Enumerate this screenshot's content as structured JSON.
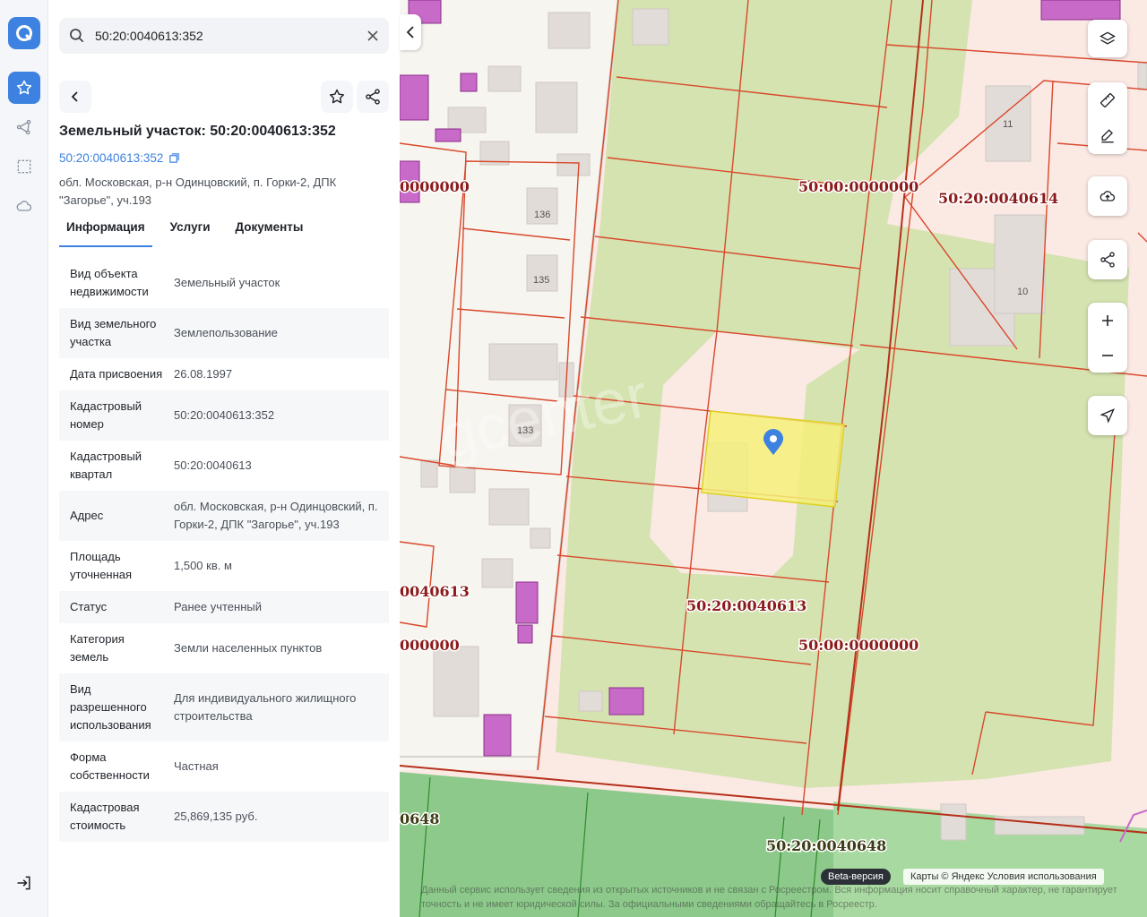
{
  "search": {
    "value": "50:20:0040613:352"
  },
  "object": {
    "title": "Земельный участок: 50:20:0040613:352",
    "cad_number": "50:20:0040613:352",
    "address": "обл. Московская, р-н Одинцовский, п. Горки-2, ДПК \"Загорье\", уч.193"
  },
  "tabs": [
    {
      "label": "Информация",
      "active": true
    },
    {
      "label": "Услуги",
      "active": false
    },
    {
      "label": "Документы",
      "active": false
    }
  ],
  "info_rows": [
    {
      "key": "Вид объекта недвижимости",
      "value": "Земельный участок"
    },
    {
      "key": "Вид земельного участка",
      "value": "Землепользование"
    },
    {
      "key": "Дата присвоения",
      "value": "26.08.1997"
    },
    {
      "key": "Кадастровый номер",
      "value": "50:20:0040613:352"
    },
    {
      "key": "Кадастровый квартал",
      "value": "50:20:0040613"
    },
    {
      "key": "Адрес",
      "value": "обл. Московская, р-н Одинцовский, п. Горки-2, ДПК \"Загорье\", уч.193"
    },
    {
      "key": "Площадь уточненная",
      "value": "1,500 кв. м"
    },
    {
      "key": "Статус",
      "value": "Ранее учтенный"
    },
    {
      "key": "Категория земель",
      "value": "Земли населенных пунктов"
    },
    {
      "key": "Вид разрешенного использования",
      "value": "Для индивидуального жилищного строительства"
    },
    {
      "key": "Форма собственности",
      "value": "Частная"
    },
    {
      "key": "Кадастровая стоимость",
      "value": "25,869,135 руб."
    }
  ],
  "map": {
    "labels": {
      "q_0000000_a": "50:00:0000000",
      "q_0000000_b": "50:00:0000000",
      "q_0040614": "50:20:0040614",
      "q_0040613": "50:20:0040613",
      "q_0040648": "50:20:0040648",
      "left_a": "0000000",
      "left_b": "0040613",
      "left_c": "000000",
      "left_d": "0648"
    },
    "lot_numbers": [
      "136",
      "135",
      "133",
      "11",
      "10"
    ],
    "beta_badge": "Beta-версия",
    "attribution": "Карты © Яндекс   Условия использования",
    "disclaimer": "Данный сервис использует сведения из открытых источников и не связан с Росреестром. Вся информация носит справочный характер, не гарантирует точность и не имеет юридической силы. За официальными сведениями обращайтесь в Росреестр.",
    "watermark": "gcenter"
  },
  "colors": {
    "accent": "#3d82e0",
    "parcel_border": "#d9482b",
    "selected_parcel": "#f5f07a",
    "green_area": "#d4e3b0",
    "forest": "#8cc98a",
    "building_purple": "#c86ac8"
  }
}
